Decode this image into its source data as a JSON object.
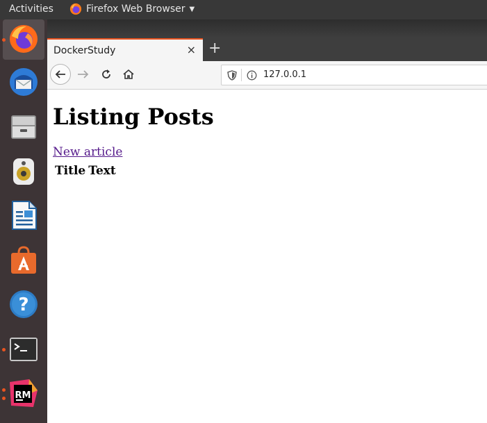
{
  "topbar": {
    "activities": "Activities",
    "app_name": "Firefox Web Browser"
  },
  "dock": {
    "items": [
      {
        "icon": "firefox-icon",
        "running": true,
        "active": true
      },
      {
        "icon": "thunderbird-icon",
        "running": false
      },
      {
        "icon": "file-cabinet-icon",
        "running": false
      },
      {
        "icon": "speaker-icon",
        "running": false
      },
      {
        "icon": "writer-icon",
        "running": false
      },
      {
        "icon": "software-store-icon",
        "running": false
      },
      {
        "icon": "help-icon",
        "running": false
      },
      {
        "icon": "terminal-icon",
        "running": true
      },
      {
        "icon": "rubymine-icon",
        "running": true
      }
    ]
  },
  "browser": {
    "tab_title": "DockerStudy",
    "new_tab_symbol": "+",
    "close_symbol": "×",
    "url": "127.0.0.1",
    "accent": "#e95420"
  },
  "page": {
    "heading": "Listing Posts",
    "new_article_link": "New article",
    "table_headers": [
      "Title",
      "Text"
    ]
  }
}
